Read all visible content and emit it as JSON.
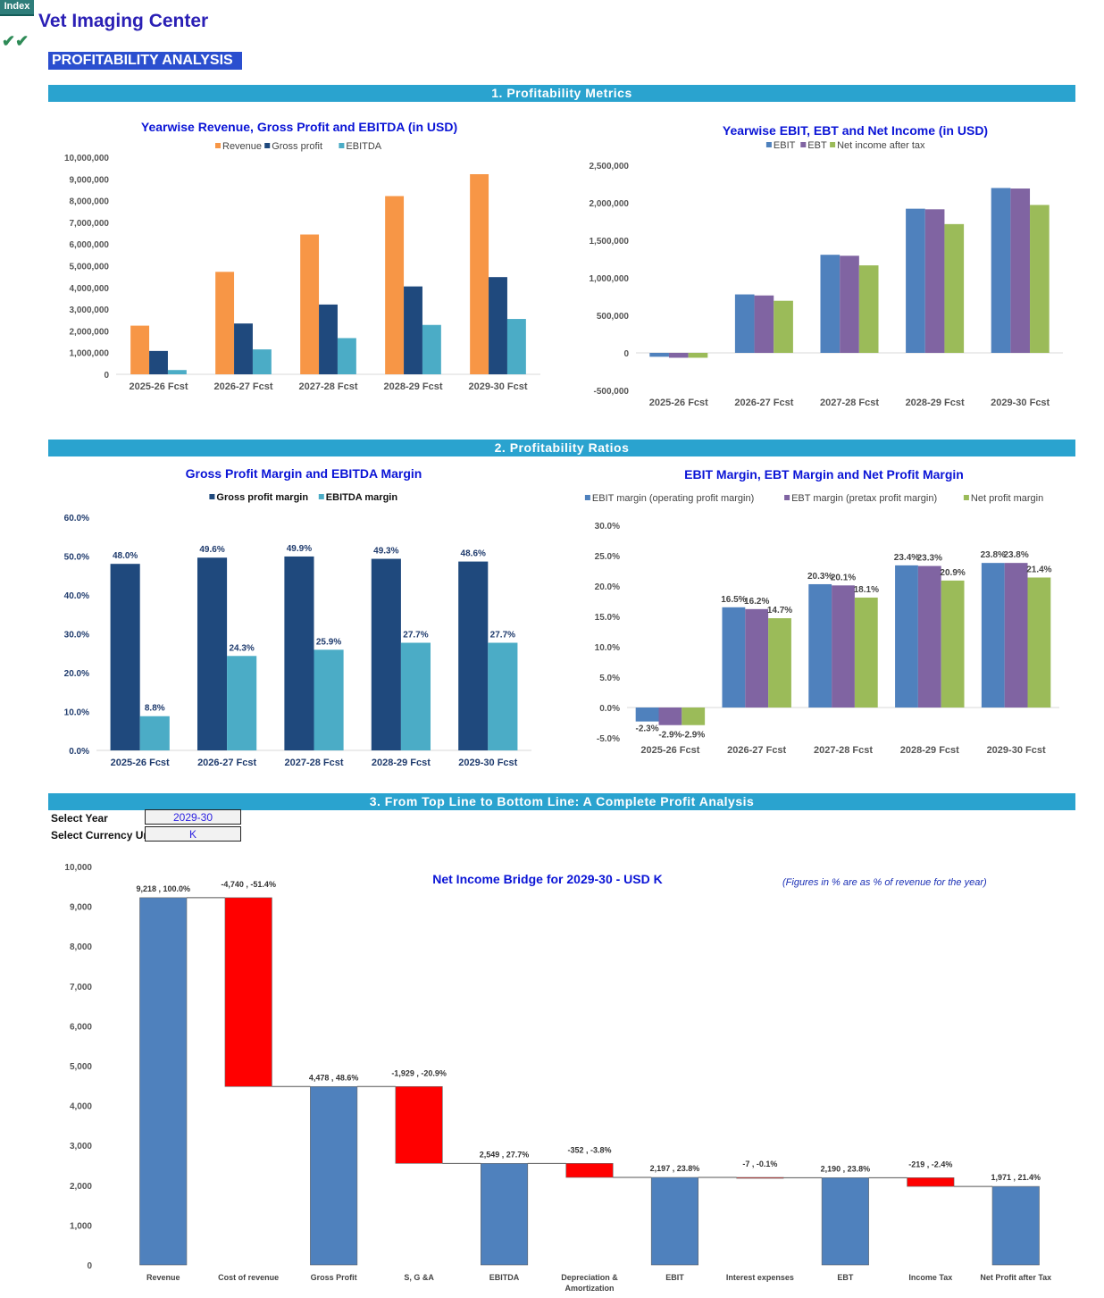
{
  "header": {
    "index_button": "Index",
    "app_title": "Vet Imaging Center",
    "checkmarks_icon": "✔✔",
    "page_title": "PROFITABILITY ANALYSIS"
  },
  "sections": {
    "s1": "1. Profitability Metrics",
    "s2": "2. Profitability Ratios",
    "s3": "3. From Top Line to Bottom Line: A Complete Profit Analysis"
  },
  "selectors": {
    "year_label": "Select Year",
    "year_value": "2029-30",
    "currency_label": "Select Currency Uni",
    "currency_value": "K"
  },
  "bridge_note": "(Figures in % are as % of revenue for the year)",
  "colors": {
    "revenue": "#f79646",
    "gross_profit": "#1f497d",
    "ebitda": "#4bacc6",
    "ebit": "#4f81bd",
    "ebt": "#8064a2",
    "net": "#9bbb59",
    "negative": "#ff0000",
    "title_blue": "#0a14d6",
    "banner": "#2aa3cf"
  },
  "chart_data": [
    {
      "id": "rev",
      "type": "bar",
      "title": "Yearwise Revenue, Gross Profit and EBITDA (in USD)",
      "categories": [
        "2025-26 Fcst",
        "2026-27 Fcst",
        "2027-28 Fcst",
        "2028-29 Fcst",
        "2029-30 Fcst"
      ],
      "series": [
        {
          "name": "Revenue",
          "color": "#f79646",
          "values": [
            2240000,
            4720000,
            6440000,
            8210000,
            9218000
          ]
        },
        {
          "name": "Gross profit",
          "color": "#1f497d",
          "values": [
            1075000,
            2341000,
            3214000,
            4048000,
            4478000
          ]
        },
        {
          "name": "EBITDA",
          "color": "#4bacc6",
          "values": [
            197000,
            1147000,
            1668000,
            2274000,
            2549000
          ]
        }
      ],
      "ylim": [
        0,
        10000000
      ],
      "yticks": [
        0,
        1000000,
        2000000,
        3000000,
        4000000,
        5000000,
        6000000,
        7000000,
        8000000,
        9000000,
        10000000
      ],
      "ytick_labels": [
        "0",
        "1,000,000",
        "2,000,000",
        "3,000,000",
        "4,000,000",
        "5,000,000",
        "6,000,000",
        "7,000,000",
        "8,000,000",
        "9,000,000",
        "10,000,000"
      ],
      "legend": "top",
      "grid": false
    },
    {
      "id": "ebit",
      "type": "bar",
      "title": "Yearwise EBIT, EBT and Net Income (in USD)",
      "categories": [
        "2025-26 Fcst",
        "2026-27 Fcst",
        "2027-28 Fcst",
        "2028-29 Fcst",
        "2029-30 Fcst"
      ],
      "series": [
        {
          "name": "EBIT",
          "color": "#4f81bd",
          "values": [
            -52000,
            779000,
            1307000,
            1921000,
            2197000
          ]
        },
        {
          "name": "EBT",
          "color": "#8064a2",
          "values": [
            -65000,
            765000,
            1294000,
            1913000,
            2190000
          ]
        },
        {
          "name": "Net income after tax",
          "color": "#9bbb59",
          "values": [
            -65000,
            694000,
            1166000,
            1716000,
            1971000
          ]
        }
      ],
      "ylim": [
        -500000,
        2500000
      ],
      "yticks": [
        -500000,
        0,
        500000,
        1000000,
        1500000,
        2000000,
        2500000
      ],
      "ytick_labels": [
        "-500,000",
        "0",
        "500,000",
        "1,000,000",
        "1,500,000",
        "2,000,000",
        "2,500,000"
      ],
      "legend": "top",
      "grid": false
    },
    {
      "id": "gpm",
      "type": "bar",
      "title": "Gross Profit Margin and  EBITDA Margin",
      "categories": [
        "2025-26 Fcst",
        "2026-27 Fcst",
        "2027-28 Fcst",
        "2028-29 Fcst",
        "2029-30 Fcst"
      ],
      "series": [
        {
          "name": "Gross profit margin",
          "color": "#1f497d",
          "values": [
            48.0,
            49.6,
            49.9,
            49.3,
            48.6
          ],
          "labels": [
            "48.0%",
            "49.6%",
            "49.9%",
            "49.3%",
            "48.6%"
          ]
        },
        {
          "name": "EBITDA margin",
          "color": "#4bacc6",
          "values": [
            8.8,
            24.3,
            25.9,
            27.7,
            27.7
          ],
          "labels": [
            "8.8%",
            "24.3%",
            "25.9%",
            "27.7%",
            "27.7%"
          ]
        }
      ],
      "ylim": [
        0,
        60
      ],
      "yticks": [
        0,
        10,
        20,
        30,
        40,
        50,
        60
      ],
      "ytick_labels": [
        "0.0%",
        "10.0%",
        "20.0%",
        "30.0%",
        "40.0%",
        "50.0%",
        "60.0%"
      ],
      "legend": "top",
      "grid": false
    },
    {
      "id": "npm",
      "type": "bar",
      "title": "EBIT Margin, EBT Margin and Net Profit Margin",
      "categories": [
        "2025-26 Fcst",
        "2026-27 Fcst",
        "2027-28 Fcst",
        "2028-29 Fcst",
        "2029-30 Fcst"
      ],
      "series": [
        {
          "name": "EBIT margin (operating profit margin)",
          "color": "#4f81bd",
          "values": [
            -2.3,
            16.5,
            20.3,
            23.4,
            23.8
          ],
          "labels": [
            "-2.3%",
            "16.5%",
            "20.3%",
            "23.4%",
            "23.8%"
          ]
        },
        {
          "name": "EBT margin (pretax profit margin)",
          "color": "#8064a2",
          "values": [
            -2.9,
            16.2,
            20.1,
            23.3,
            23.8
          ],
          "labels": [
            "-2.9%",
            "16.2%",
            "20.1%",
            "23.3%",
            "23.8%"
          ]
        },
        {
          "name": "Net profit margin",
          "color": "#9bbb59",
          "values": [
            -2.9,
            14.7,
            18.1,
            20.9,
            21.4
          ],
          "labels": [
            "-2.9%",
            "14.7%",
            "18.1%",
            "20.9%",
            "21.4%"
          ]
        }
      ],
      "ylim": [
        -5,
        30
      ],
      "yticks": [
        -5,
        0,
        5,
        10,
        15,
        20,
        25,
        30
      ],
      "ytick_labels": [
        "-5.0%",
        "0.0%",
        "5.0%",
        "10.0%",
        "15.0%",
        "20.0%",
        "25.0%",
        "30.0%"
      ],
      "legend": "top",
      "grid": false
    },
    {
      "id": "bridge",
      "type": "bar",
      "subtype": "waterfall",
      "title": "Net Income Bridge for 2029-30 - USD K",
      "categories": [
        "Revenue",
        "Cost of revenue",
        "Gross Profit",
        "S, G &A",
        "EBITDA",
        "Depreciation & Amortization",
        "EBIT",
        "Interest expenses",
        "EBT",
        "Income Tax",
        "Net Profit after Tax"
      ],
      "values": [
        9218,
        -4740,
        4478,
        -1929,
        2549,
        -352,
        2197,
        -7,
        2190,
        -219,
        1971
      ],
      "kinds": [
        "total",
        "delta",
        "total",
        "delta",
        "total",
        "delta",
        "total",
        "delta",
        "total",
        "delta",
        "total"
      ],
      "labels": [
        "9,218 , 100.0%",
        "-4,740 , -51.4%",
        "4,478 , 48.6%",
        "-1,929 , -20.9%",
        "2,549 , 27.7%",
        "-352 , -3.8%",
        "2,197 , 23.8%",
        "-7 , -0.1%",
        "2,190 , 23.8%",
        "-219 , -2.4%",
        "1,971 , 21.4%"
      ],
      "ylim": [
        0,
        10000
      ],
      "yticks": [
        0,
        1000,
        2000,
        3000,
        4000,
        5000,
        6000,
        7000,
        8000,
        9000,
        10000
      ],
      "ytick_labels": [
        "0",
        "1,000",
        "2,000",
        "3,000",
        "4,000",
        "5,000",
        "6,000",
        "7,000",
        "8,000",
        "9,000",
        "10,000"
      ],
      "grid": false
    }
  ]
}
